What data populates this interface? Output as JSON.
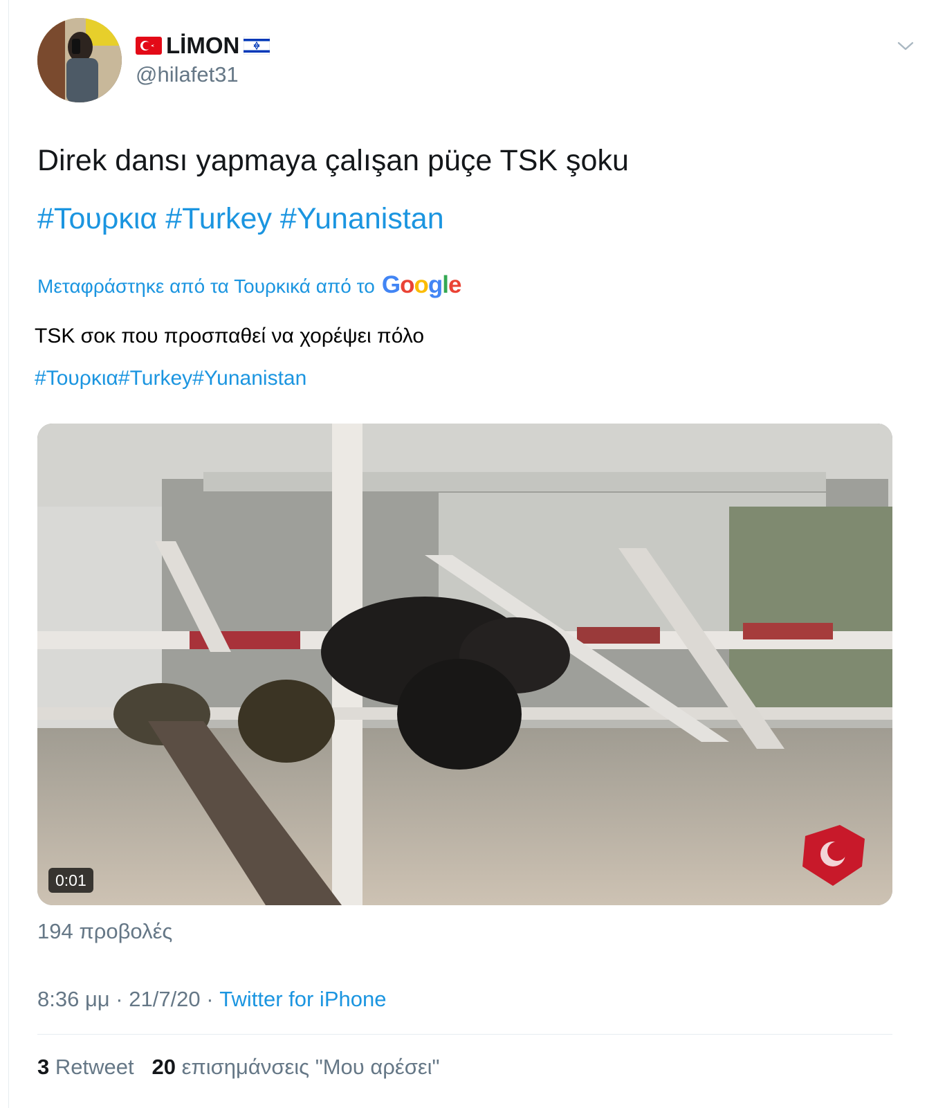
{
  "user": {
    "display_name": "LİMON",
    "handle": "@hilafet31",
    "name_prefix_flag": "turkey-flag",
    "name_suffix_flag": "israel-flag"
  },
  "tweet": {
    "text": "Direk dansı yapmaya çalışan püçe TSK şoku",
    "hashtags": [
      "#Τουρκια",
      "#Turkey",
      "#Yunanistan"
    ]
  },
  "translation": {
    "label": "Μεταφράστηκε από τα Τουρκικά από το",
    "provider_letters": [
      "G",
      "o",
      "o",
      "g",
      "l",
      "e"
    ],
    "text": "TSK σοκ που προσπαθεί να χορέψει πόλο",
    "hashtags": "#Τουρκια#Turkey#Yunanistan"
  },
  "video": {
    "duration": "0:01"
  },
  "views": "194 προβολές",
  "meta": {
    "time": "8:36 μμ",
    "separator": " · ",
    "date": "21/7/20",
    "source": "Twitter for iPhone"
  },
  "stats": {
    "retweet_count": "3",
    "retweet_label": "Retweet",
    "like_count": "20",
    "like_label": "επισημάνσεις \"Μου αρέσει\""
  },
  "colors": {
    "link": "#1b95e0",
    "secondary_text": "#657786",
    "primary_text": "#14171a",
    "divider": "#e6ecf0"
  }
}
